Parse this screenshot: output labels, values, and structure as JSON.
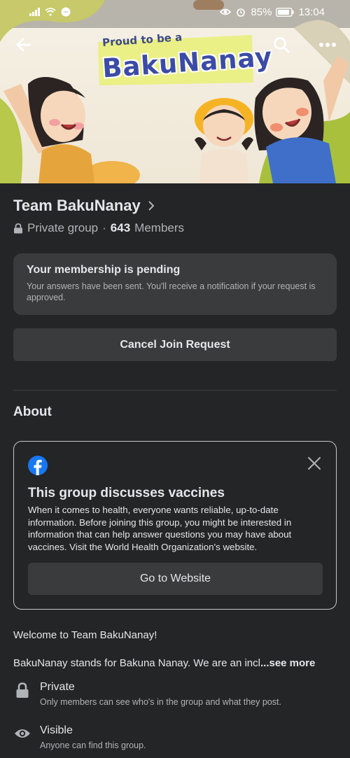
{
  "status": {
    "battery": "85%",
    "time": "13:04"
  },
  "cover": {
    "banner_sub": "Proud to be a",
    "banner_title": "BakuNanay"
  },
  "group": {
    "name": "Team BakuNanay",
    "privacy": "Private group",
    "separator": "·",
    "member_count": "643",
    "members_label": "Members"
  },
  "pending": {
    "title": "Your membership is pending",
    "text": "Your answers have been sent. You'll receive a notification if your request is approved."
  },
  "cancel_label": "Cancel Join Request",
  "about": {
    "heading": "About",
    "vaccine_card": {
      "title": "This group discusses vaccines",
      "text": "When it comes to health, everyone wants reliable, up-to-date information. Before joining this group, you might be interested in information that can help answer questions you may have about vaccines. Visit the World Health Organization's website.",
      "button": "Go to Website"
    },
    "welcome": "Welcome to Team BakuNanay!",
    "description": "BakuNanay stands for Bakuna Nanay. We are an incl",
    "see_more": "...see more",
    "private": {
      "title": "Private",
      "sub": "Only members can see who's in the group and what they post."
    },
    "visible": {
      "title": "Visible",
      "sub": "Anyone can find this group."
    }
  },
  "colors": {
    "background": "#242526",
    "card": "#3a3b3c",
    "text_primary": "#e4e6eb",
    "text_secondary": "#b0b3b8",
    "facebook_blue": "#1877f2"
  },
  "icons": [
    "back-arrow-icon",
    "search-icon",
    "more-icon",
    "chevron-right-icon",
    "lock-icon",
    "facebook-logo-icon",
    "close-icon",
    "eye-icon"
  ]
}
